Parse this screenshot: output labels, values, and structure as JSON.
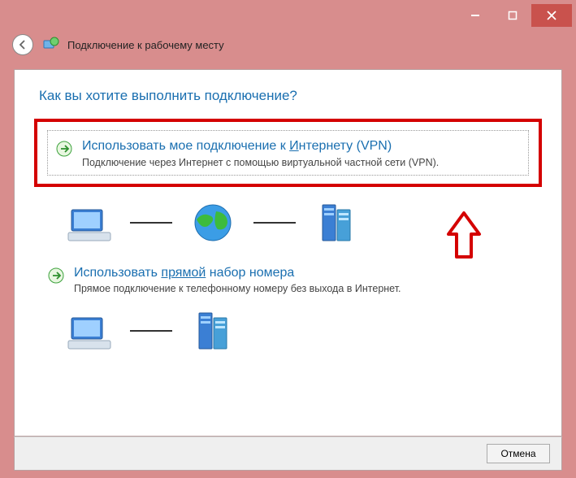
{
  "titlebar": {
    "minimize_icon": "minimize-icon",
    "maximize_icon": "maximize-icon",
    "close_icon": "close-icon"
  },
  "header": {
    "title": "Подключение к рабочему месту"
  },
  "main": {
    "question": "Как вы хотите выполнить подключение?",
    "options": [
      {
        "title_pre": "Использовать мое подключение к ",
        "title_ul": "И",
        "title_post": "нтернету (VPN)",
        "desc": "Подключение через Интернет с помощью виртуальной частной сети (VPN)."
      },
      {
        "title_pre": "Использовать ",
        "title_ul": "прямой",
        "title_post": " набор номера",
        "desc": "Прямое подключение к телефонному номеру без выхода в Интернет."
      }
    ]
  },
  "footer": {
    "cancel": "Отмена"
  },
  "colors": {
    "accent": "#1a6fb0",
    "highlight": "#d40000",
    "chrome": "#d88d8d"
  }
}
